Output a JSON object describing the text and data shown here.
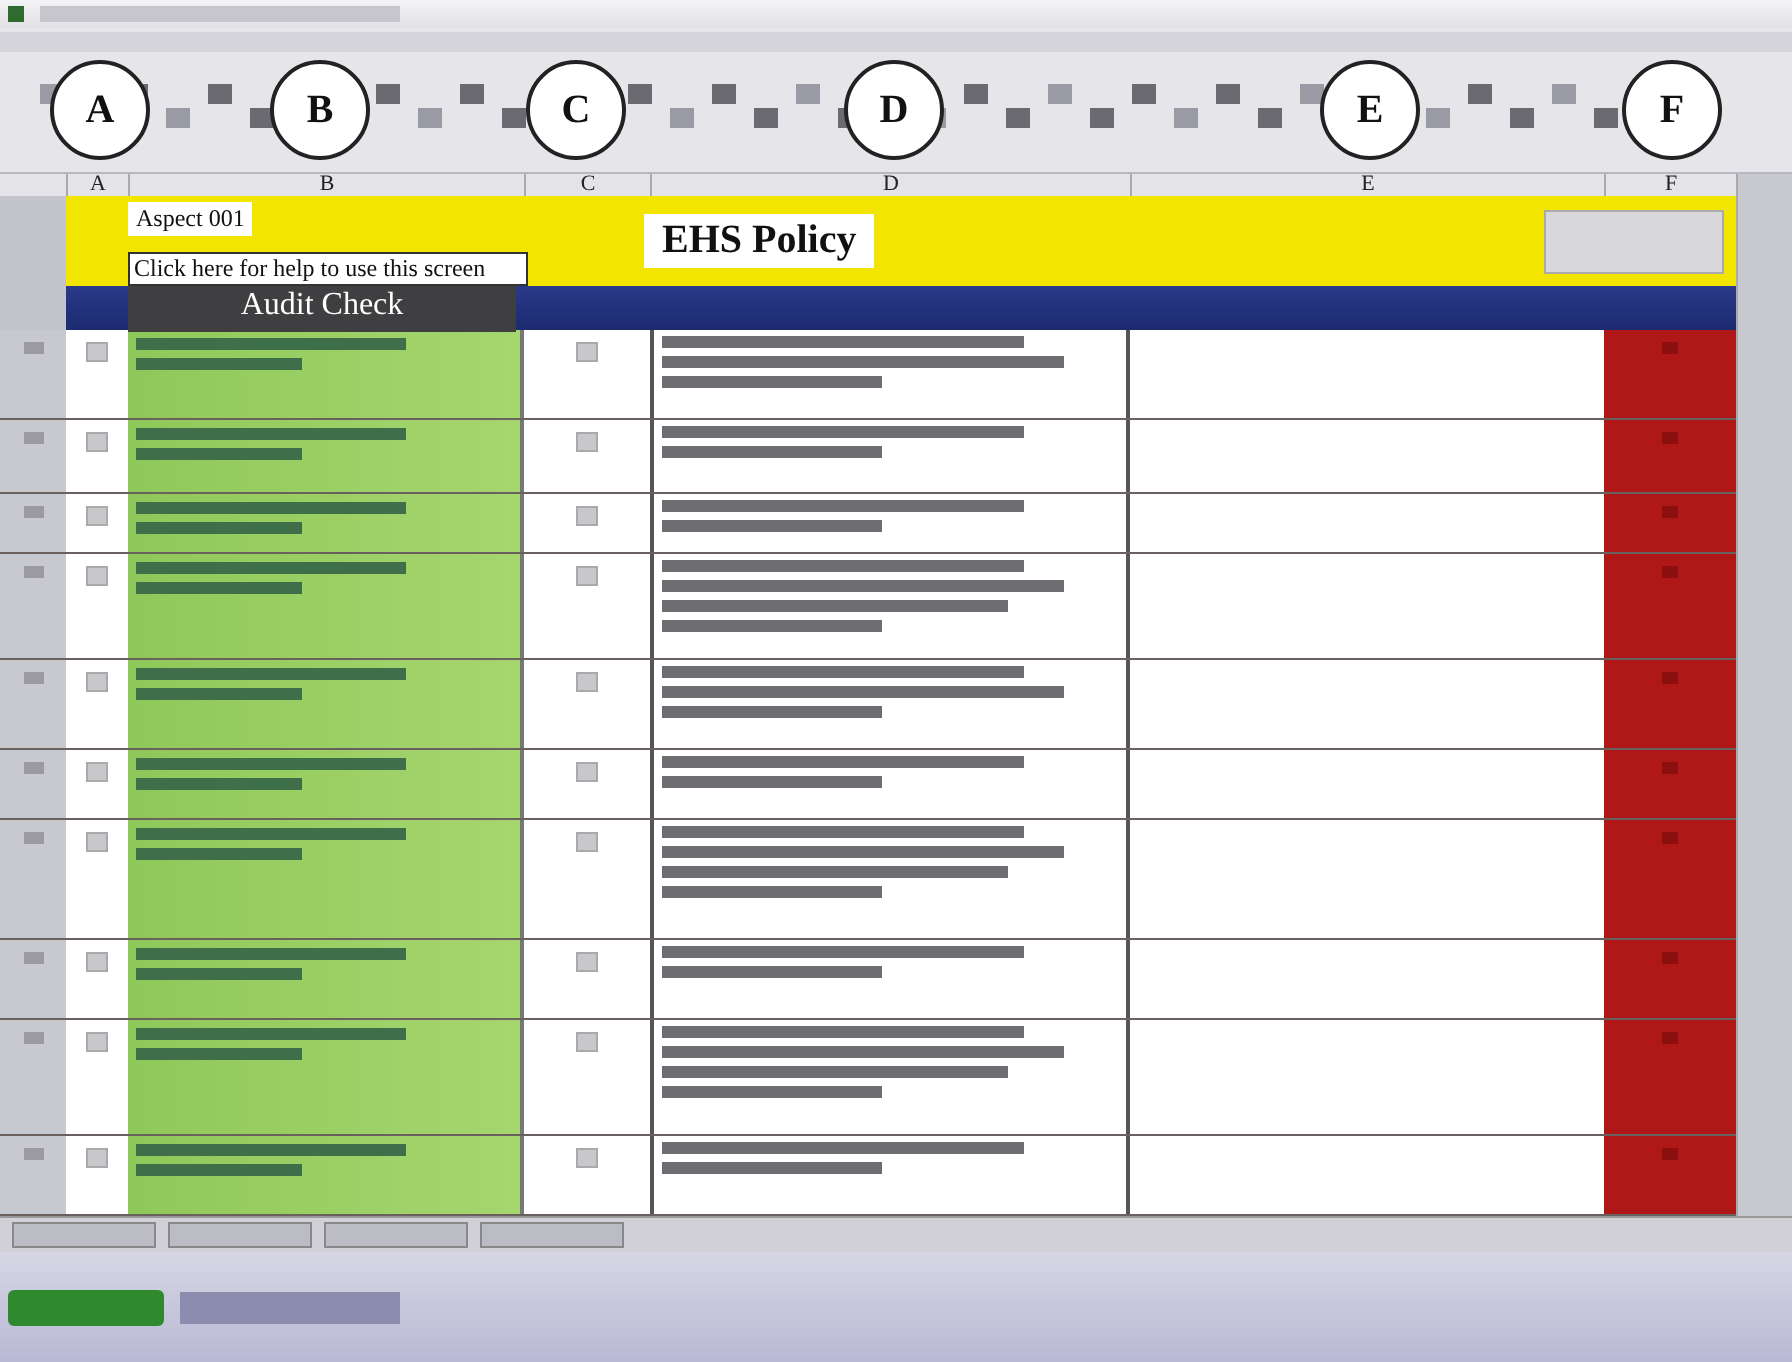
{
  "annotations": [
    {
      "label": "A"
    },
    {
      "label": "B"
    },
    {
      "label": "C"
    },
    {
      "label": "D"
    },
    {
      "label": "E"
    },
    {
      "label": "F"
    }
  ],
  "column_headers": [
    "A",
    "B",
    "C",
    "D",
    "E",
    "F"
  ],
  "banner": {
    "aspect": "Aspect 001",
    "title": "EHS Policy",
    "help_link": "Click here for help to use this screen"
  },
  "section_heading": "Audit Check"
}
